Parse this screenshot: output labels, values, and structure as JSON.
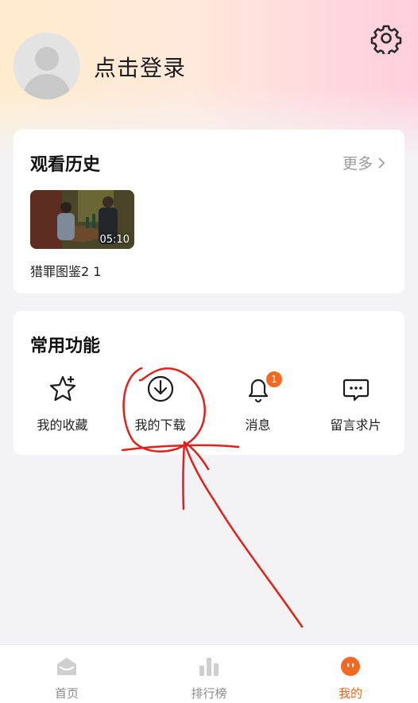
{
  "profile": {
    "login_text": "点击登录"
  },
  "history": {
    "title": "观看历史",
    "more_label": "更多",
    "items": [
      {
        "title": "猎罪图鉴2 1",
        "duration": "05:10"
      }
    ]
  },
  "functions": {
    "title": "常用功能",
    "items": [
      {
        "label": "我的收藏",
        "icon": "star-icon"
      },
      {
        "label": "我的下载",
        "icon": "download-icon"
      },
      {
        "label": "消息",
        "icon": "bell-icon",
        "badge": "1"
      },
      {
        "label": "留言求片",
        "icon": "message-icon"
      }
    ]
  },
  "tabbar": {
    "items": [
      {
        "label": "首页",
        "icon": "home-icon"
      },
      {
        "label": "排行榜",
        "icon": "ranking-icon"
      },
      {
        "label": "我的",
        "icon": "profile-face-icon"
      }
    ],
    "active": 2
  },
  "colors": {
    "accent": "#f26a21",
    "annotation": "#e0201a",
    "badge": "#f26a21"
  }
}
